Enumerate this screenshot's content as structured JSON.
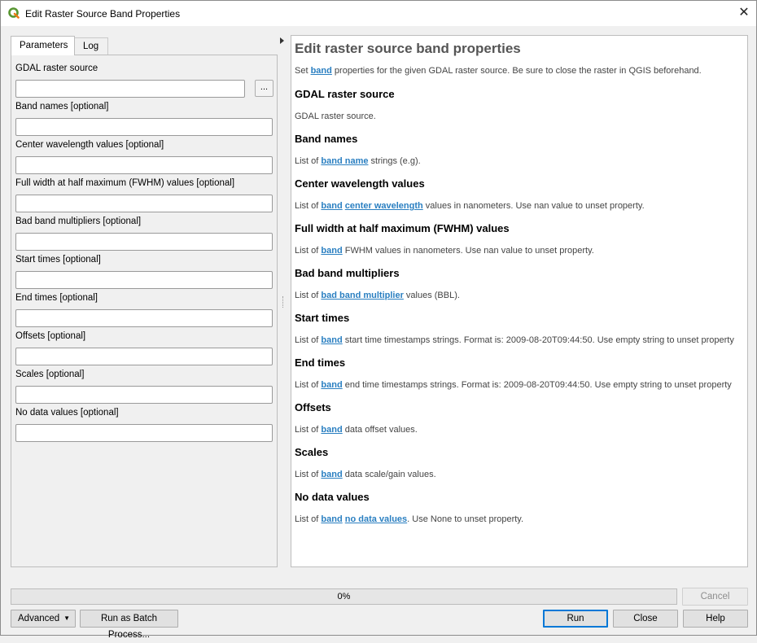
{
  "window": {
    "title": "Edit Raster Source Band Properties",
    "close_glyph": "✕"
  },
  "tabs": [
    {
      "label": "Parameters"
    },
    {
      "label": "Log"
    }
  ],
  "params": {
    "fields": [
      {
        "label": "GDAL raster source",
        "value": ""
      },
      {
        "label": "Band names [optional]",
        "value": ""
      },
      {
        "label": "Center wavelength values [optional]",
        "value": ""
      },
      {
        "label": "Full width at half maximum (FWHM) values [optional]",
        "value": ""
      },
      {
        "label": "Bad band multipliers [optional]",
        "value": ""
      },
      {
        "label": "Start times [optional]",
        "value": ""
      },
      {
        "label": "End times [optional]",
        "value": ""
      },
      {
        "label": "Offsets [optional]",
        "value": ""
      },
      {
        "label": "Scales [optional]",
        "value": ""
      },
      {
        "label": "No data values [optional]",
        "value": ""
      }
    ],
    "browse_label": "..."
  },
  "help": {
    "title": "Edit raster source band properties",
    "intro": {
      "pre": "Set ",
      "link": "band",
      "post": " properties for the given GDAL raster source. Be sure to close the raster in QGIS beforehand."
    },
    "sections": [
      {
        "heading": "GDAL raster source",
        "text": "GDAL raster source."
      },
      {
        "heading": "Band names",
        "pre": "List of ",
        "link1": "band name",
        "post": " strings (e.g)."
      },
      {
        "heading": "Center wavelength values",
        "pre": "List of ",
        "link1": "band",
        "mid": " ",
        "link2": "center wavelength",
        "post": " values in nanometers. Use nan value to unset property."
      },
      {
        "heading": "Full width at half maximum (FWHM) values",
        "pre": "List of ",
        "link1": "band",
        "post": " FWHM values in nanometers. Use nan value to unset property."
      },
      {
        "heading": "Bad band multipliers",
        "pre": "List of ",
        "link1": "bad band multiplier",
        "post": " values (BBL)."
      },
      {
        "heading": "Start times",
        "pre": "List of ",
        "link1": "band",
        "post": " start time timestamps strings. Format is: 2009-08-20T09:44:50. Use empty string to unset property"
      },
      {
        "heading": "End times",
        "pre": "List of ",
        "link1": "band",
        "post": " end time timestamps strings. Format is: 2009-08-20T09:44:50. Use empty string to unset property"
      },
      {
        "heading": "Offsets",
        "pre": "List of ",
        "link1": "band",
        "post": " data offset values."
      },
      {
        "heading": "Scales",
        "pre": "List of ",
        "link1": "band",
        "post": " data scale/gain values."
      },
      {
        "heading": "No data values",
        "pre": "List of ",
        "link1": "band",
        "mid": " ",
        "link2": "no data values",
        "post": ". Use None to unset property."
      }
    ]
  },
  "progress": {
    "text": "0%",
    "value": 0
  },
  "buttons": {
    "cancel": "Cancel",
    "advanced": "Advanced",
    "batch": "Run as Batch Process...",
    "run": "Run",
    "close": "Close",
    "help": "Help"
  }
}
